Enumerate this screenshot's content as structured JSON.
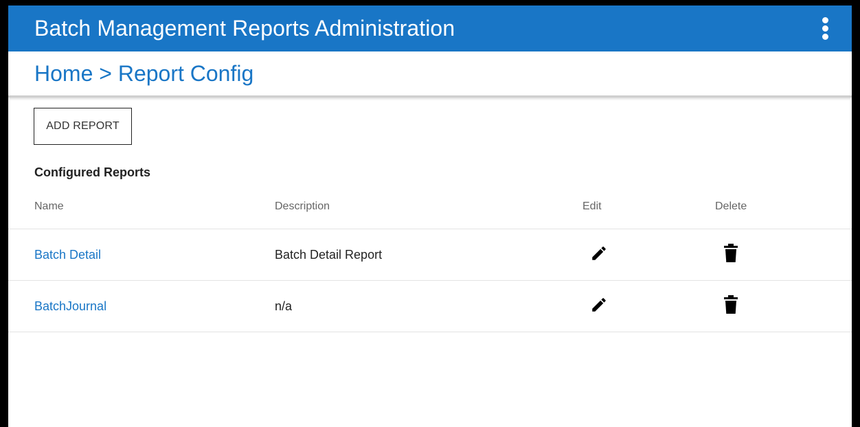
{
  "header": {
    "title": "Batch Management Reports Administration",
    "menu_icon": "more-vertical-icon"
  },
  "breadcrumb": {
    "text": "Home > Report Config"
  },
  "toolbar": {
    "add_label": "ADD REPORT"
  },
  "section": {
    "title": "Configured Reports"
  },
  "table": {
    "columns": [
      "Name",
      "Description",
      "Edit",
      "Delete"
    ],
    "rows": [
      {
        "name": "Batch Detail",
        "description": "Batch Detail Report",
        "edit_icon": "pencil-icon",
        "delete_icon": "trash-icon"
      },
      {
        "name": "BatchJournal",
        "description": "n/a",
        "edit_icon": "pencil-icon",
        "delete_icon": "trash-icon"
      }
    ]
  },
  "colors": {
    "brand": "#1976c6",
    "link": "#1976c6",
    "text": "#222222"
  }
}
